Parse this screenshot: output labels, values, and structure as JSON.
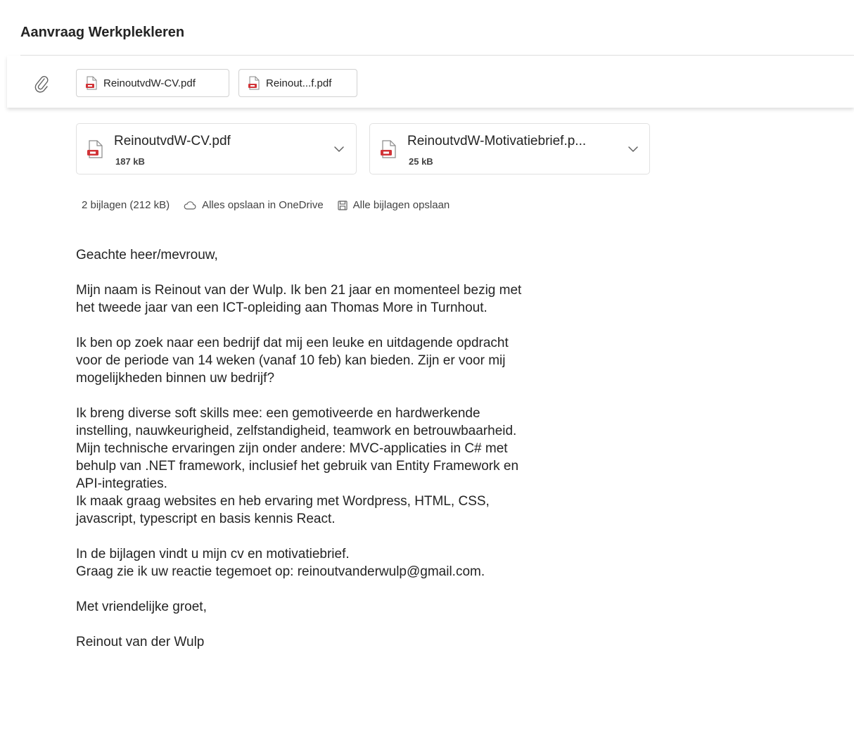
{
  "subject": "Aanvraag Werkplekleren",
  "attachment_chips": [
    {
      "label": "ReinoutvdW-CV.pdf"
    },
    {
      "label": "Reinout...f.pdf"
    }
  ],
  "attachments": [
    {
      "name": "ReinoutvdW-CV.pdf",
      "size": "187 kB"
    },
    {
      "name": "ReinoutvdW-Motivatiebrief.p...",
      "size": "25 kB"
    }
  ],
  "actions": {
    "summary": "2 bijlagen (212 kB)",
    "save_onedrive": "Alles opslaan in OneDrive",
    "save_all": "Alle bijlagen opslaan"
  },
  "body": {
    "greeting": "Geachte heer/mevrouw,",
    "p1": [
      "Mijn naam is Reinout van der Wulp. Ik ben 21 jaar en momenteel bezig met",
      "het tweede jaar van een ICT-opleiding aan Thomas More in Turnhout."
    ],
    "p2": [
      "Ik ben op zoek naar een bedrijf dat mij een leuke en uitdagende opdracht",
      "voor de periode van 14 weken (vanaf 10 feb) kan bieden. Zijn er voor mij",
      "mogelijkheden binnen uw bedrijf?"
    ],
    "p3": [
      "Ik breng diverse soft skills mee: een gemotiveerde en hardwerkende",
      "instelling, nauwkeurigheid, zelfstandigheid, teamwork en betrouwbaarheid.",
      "Mijn technische ervaringen zijn onder andere: MVC-applicaties in C# met",
      "behulp van .NET framework, inclusief het gebruik van Entity Framework en",
      "API-integraties.",
      "Ik maak graag websites en heb ervaring met Wordpress, HTML, CSS,",
      "javascript, typescript en basis kennis React."
    ],
    "p4": [
      "In de bijlagen vindt u mijn cv en motivatiebrief.",
      "Graag zie ik uw reactie tegemoet op: reinoutvanderwulp@gmail.com."
    ],
    "closing": "Met vriendelijke groet,",
    "signature": "Reinout van der Wulp"
  },
  "icons": {
    "paperclip": "paperclip-icon",
    "pdf": "pdf-file-icon",
    "chevron": "chevron-down-icon",
    "cloud": "cloud-icon",
    "save": "save-icon"
  },
  "colors": {
    "pdf_red": "#d13438",
    "text": "#242424",
    "muted": "#616161"
  }
}
